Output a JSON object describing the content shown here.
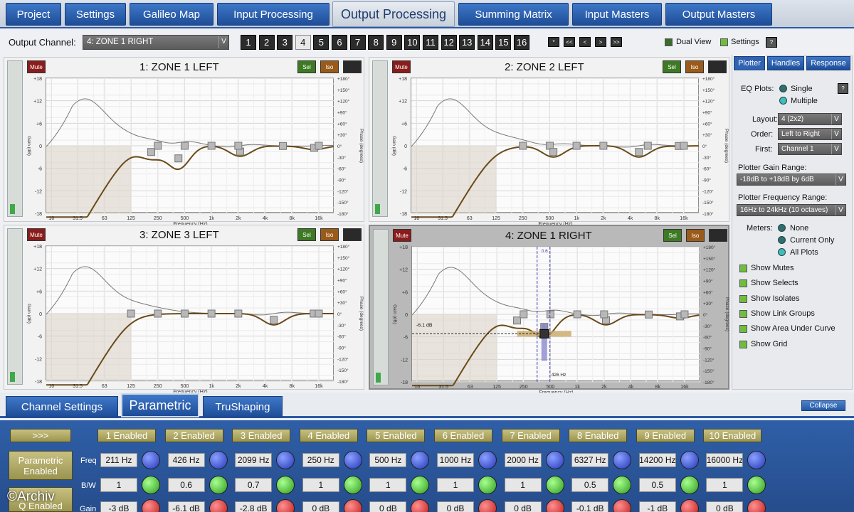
{
  "top_tabs": [
    {
      "label": "Project",
      "active": false
    },
    {
      "label": "Settings",
      "active": false
    },
    {
      "label": "Galileo Map",
      "active": false
    },
    {
      "label": "Input Processing",
      "active": false
    },
    {
      "label": "Output Processing",
      "active": true
    },
    {
      "label": "Summing Matrix",
      "active": false
    },
    {
      "label": "Input Masters",
      "active": false
    },
    {
      "label": "Output Masters",
      "active": false
    }
  ],
  "output_channel": {
    "label": "Output Channel:",
    "value": "4: ZONE 1 RIGHT",
    "arrow": "V",
    "buttons": [
      "1",
      "2",
      "3",
      "4",
      "5",
      "6",
      "7",
      "8",
      "9",
      "10",
      "11",
      "12",
      "13",
      "14",
      "15",
      "16"
    ],
    "active_index": 3,
    "nav": [
      "*",
      "<<",
      "<",
      ">",
      ">>"
    ],
    "dual_view_label": "Dual View",
    "settings_label": "Settings",
    "help_label": "?"
  },
  "plots": [
    {
      "title": "1: ZONE 1 LEFT",
      "selected": false,
      "mute": "Mute",
      "sel": "Sel",
      "iso": "Iso",
      "eq_db": [
        -3.0,
        -6.1,
        -2.8,
        0,
        0,
        0,
        0,
        -0.1,
        -1.0,
        0
      ],
      "eq_freq": [
        211,
        426,
        2099,
        250,
        500,
        1000,
        2000,
        6327,
        14200,
        16000
      ]
    },
    {
      "title": "2: ZONE 2 LEFT",
      "selected": false,
      "mute": "Mute",
      "sel": "Sel",
      "iso": "Iso",
      "eq_db": [
        0,
        -3.0,
        0,
        0,
        -3.0,
        0,
        -0.1,
        0,
        0,
        0
      ],
      "eq_freq": [
        500,
        550,
        1000,
        2000,
        5000,
        6300,
        14000,
        16000,
        250,
        125
      ]
    },
    {
      "title": "3: ZONE 3 LEFT",
      "selected": false,
      "mute": "Mute",
      "sel": "Sel",
      "iso": "Iso",
      "eq_db": [
        0,
        0,
        0,
        0,
        -3.0,
        0,
        0,
        0,
        0,
        0
      ],
      "eq_freq": [
        250,
        500,
        1000,
        2000,
        5000,
        14000,
        16000,
        125,
        63,
        31.5
      ]
    },
    {
      "title": "4: ZONE 1 RIGHT",
      "selected": true,
      "mute": "Mute",
      "sel": "Sel",
      "iso": "Iso",
      "eq_db": [
        -3.0,
        -6.1,
        -2.8,
        0,
        0,
        0,
        0,
        -0.1,
        -1.0,
        0
      ],
      "eq_freq": [
        211,
        426,
        2099,
        250,
        500,
        1000,
        2000,
        6327,
        14200,
        16000
      ],
      "cursor_gain": "-6.1 dB",
      "cursor_freq": "426 Hz",
      "cursor_bw": "0.6"
    }
  ],
  "axes": {
    "gain_ticks": [
      "+18",
      "+12",
      "+6",
      "0",
      "-6",
      "-12",
      "-18"
    ],
    "phase_ticks": [
      "+180°",
      "+150°",
      "+120°",
      "+90°",
      "+60°",
      "+30°",
      "0°",
      "-30°",
      "-60°",
      "-90°",
      "-120°",
      "-150°",
      "-180°"
    ],
    "freq_ticks": [
      "16",
      "31.5",
      "63",
      "125",
      "250",
      "500",
      "1k",
      "2k",
      "4k",
      "8k",
      "16k"
    ],
    "xlabel": "Frequency (Hz)",
    "ylabel_left": "Gain (dB)",
    "ylabel_right": "Phase (degrees)"
  },
  "right_panel": {
    "tabs": [
      "Plotter",
      "Handles",
      "Response"
    ],
    "active_tab": 0,
    "eq_plots_label": "EQ Plots:",
    "eq_single": "Single",
    "eq_multiple": "Multiple",
    "help": "?",
    "layout_label": "Layout:",
    "layout_value": "4 (2x2)",
    "order_label": "Order:",
    "order_value": "Left to Right",
    "first_label": "First:",
    "first_value": "Channel 1",
    "gain_range_label": "Plotter Gain Range:",
    "gain_range_value": "-18dB to +18dB by 6dB",
    "freq_range_label": "Plotter Frequency Range:",
    "freq_range_value": "16Hz to 24kHz (10 octaves)",
    "meters_label": "Meters:",
    "meters_none": "None",
    "meters_current": "Current Only",
    "meters_all": "All Plots",
    "checkboxes": [
      "Show Mutes",
      "Show Selects",
      "Show Isolates",
      "Show Link Groups",
      "Show Area Under Curve",
      "Show Grid"
    ],
    "arrow": "V"
  },
  "bottom_tabs": [
    {
      "label": "Channel Settings",
      "active": false
    },
    {
      "label": "Parametric",
      "active": true
    },
    {
      "label": "TruShaping",
      "active": false
    }
  ],
  "collapse_label": "Collapse",
  "parametric": {
    "expand_label": ">>>",
    "enabled_label": "Parametric Enabled",
    "second_label": "Q Enabled",
    "freq_label": "Freq",
    "bw_label": "B/W",
    "gain_label": "Gain",
    "bands": [
      {
        "label": "1 Enabled",
        "freq": "211 Hz",
        "bw": "1",
        "gain": "-3 dB"
      },
      {
        "label": "2 Enabled",
        "freq": "426 Hz",
        "bw": "0.6",
        "gain": "-6.1 dB"
      },
      {
        "label": "3 Enabled",
        "freq": "2099 Hz",
        "bw": "0.7",
        "gain": "-2.8 dB"
      },
      {
        "label": "4 Enabled",
        "freq": "250 Hz",
        "bw": "1",
        "gain": "0 dB"
      },
      {
        "label": "5 Enabled",
        "freq": "500 Hz",
        "bw": "1",
        "gain": "0 dB"
      },
      {
        "label": "6 Enabled",
        "freq": "1000 Hz",
        "bw": "1",
        "gain": "0 dB"
      },
      {
        "label": "7 Enabled",
        "freq": "2000 Hz",
        "bw": "1",
        "gain": "0 dB"
      },
      {
        "label": "8 Enabled",
        "freq": "6327 Hz",
        "bw": "0.5",
        "gain": "-0.1 dB"
      },
      {
        "label": "9 Enabled",
        "freq": "14200 Hz",
        "bw": "0.5",
        "gain": "-1 dB"
      },
      {
        "label": "10 Enabled",
        "freq": "16000 Hz",
        "bw": "1",
        "gain": "0 dB"
      }
    ]
  },
  "watermark": "©Archiv",
  "colors": {
    "accent": "#2a5aa8",
    "curve": "#6b4a1a",
    "phase": "#777777",
    "area": "#d9d2c4"
  }
}
